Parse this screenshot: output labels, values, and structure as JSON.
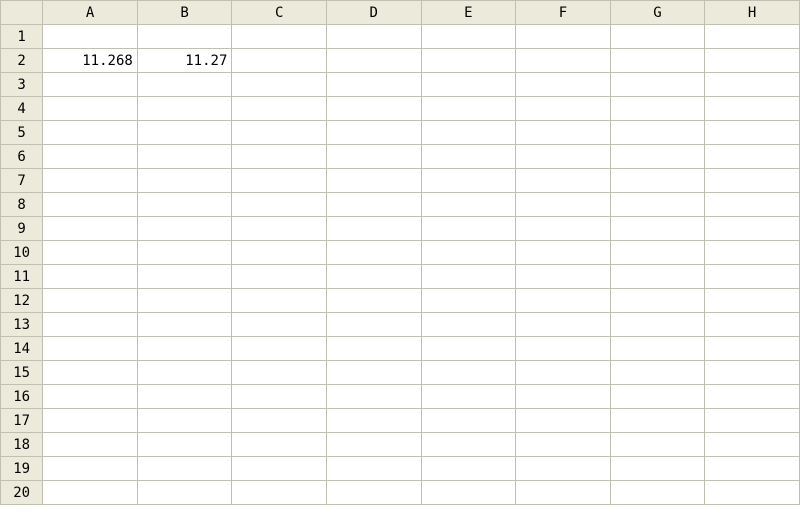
{
  "columns": [
    "A",
    "B",
    "C",
    "D",
    "E",
    "F",
    "G",
    "H"
  ],
  "rows": [
    "1",
    "2",
    "3",
    "4",
    "5",
    "6",
    "7",
    "8",
    "9",
    "10",
    "11",
    "12",
    "13",
    "14",
    "15",
    "16",
    "17",
    "18",
    "19",
    "20"
  ],
  "cells": {
    "A2": "11.268",
    "B2": "11.27"
  },
  "colors": {
    "header_bg": "#eceadb",
    "grid_border": "#c0c0b0",
    "cell_bg": "#ffffff"
  }
}
